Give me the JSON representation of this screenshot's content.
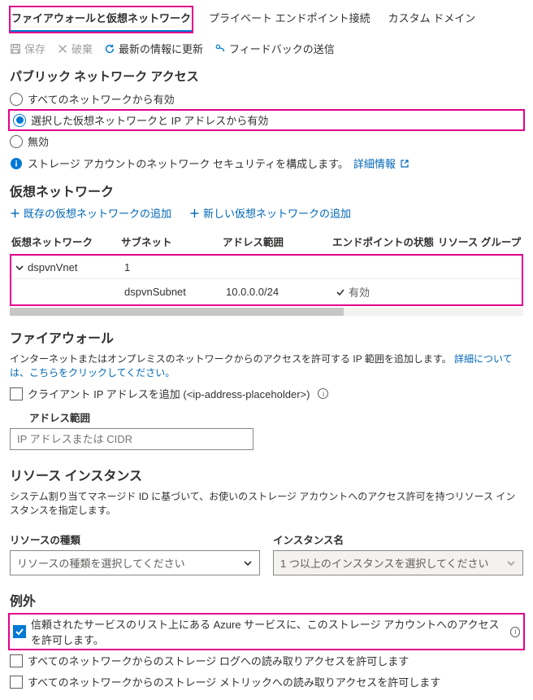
{
  "tabs": {
    "firewall": "ファイアウォールと仮想ネットワーク",
    "private_endpoint": "プライベート エンドポイント接続",
    "custom_domain": "カスタム ドメイン"
  },
  "toolbar": {
    "save": "保存",
    "discard": "破棄",
    "refresh": "最新の情報に更新",
    "feedback": "フィードバックの送信"
  },
  "public_access": {
    "title": "パブリック ネットワーク アクセス",
    "opt_all": "すべてのネットワークから有効",
    "opt_selected": "選択した仮想ネットワークと IP アドレスから有効",
    "opt_disabled": "無効",
    "info_text": "ストレージ アカウントのネットワーク セキュリティを構成します。",
    "info_link": "詳細情報"
  },
  "vnet": {
    "title": "仮想ネットワーク",
    "add_existing": "既存の仮想ネットワークの追加",
    "add_new": "新しい仮想ネットワークの追加",
    "cols": {
      "vnet": "仮想ネットワーク",
      "subnet": "サブネット",
      "range": "アドレス範囲",
      "endpoint": "エンドポイントの状態",
      "rg": "リソース グループ"
    },
    "row1": {
      "name": "dspvnVnet",
      "subnet_count": "1"
    },
    "row2": {
      "subnet": "dspvnSubnet",
      "range": "10.0.0.0/24",
      "status": "有効"
    }
  },
  "firewall": {
    "title": "ファイアウォール",
    "desc_pre": "インターネットまたはオンプレミスのネットワークからのアクセスを許可する IP 範囲を追加します。",
    "desc_link": "詳細については、こちらをクリックしてください。",
    "client_ip_label": "クライアント IP アドレスを追加 (<ip-address-placeholder>)",
    "range_label": "アドレス範囲",
    "range_placeholder": "IP アドレスまたは CIDR"
  },
  "resource_instances": {
    "title": "リソース インスタンス",
    "desc": "システム割り当てマネージド ID に基づいて、お使いのストレージ アカウントへのアクセス許可を持つリソース インスタンスを指定します。",
    "type_label": "リソースの種類",
    "type_placeholder": "リソースの種類を選択してください",
    "instance_label": "インスタンス名",
    "instance_placeholder": "1 つ以上のインスタンスを選択してください"
  },
  "exceptions": {
    "title": "例外",
    "trusted": "信頼されたサービスのリスト上にある Azure サービスに、このストレージ アカウントへのアクセスを許可します。",
    "read_logs": "すべてのネットワークからのストレージ ログへの読み取りアクセスを許可します",
    "read_metrics": "すべてのネットワークからのストレージ メトリックへの読み取りアクセスを許可します"
  }
}
